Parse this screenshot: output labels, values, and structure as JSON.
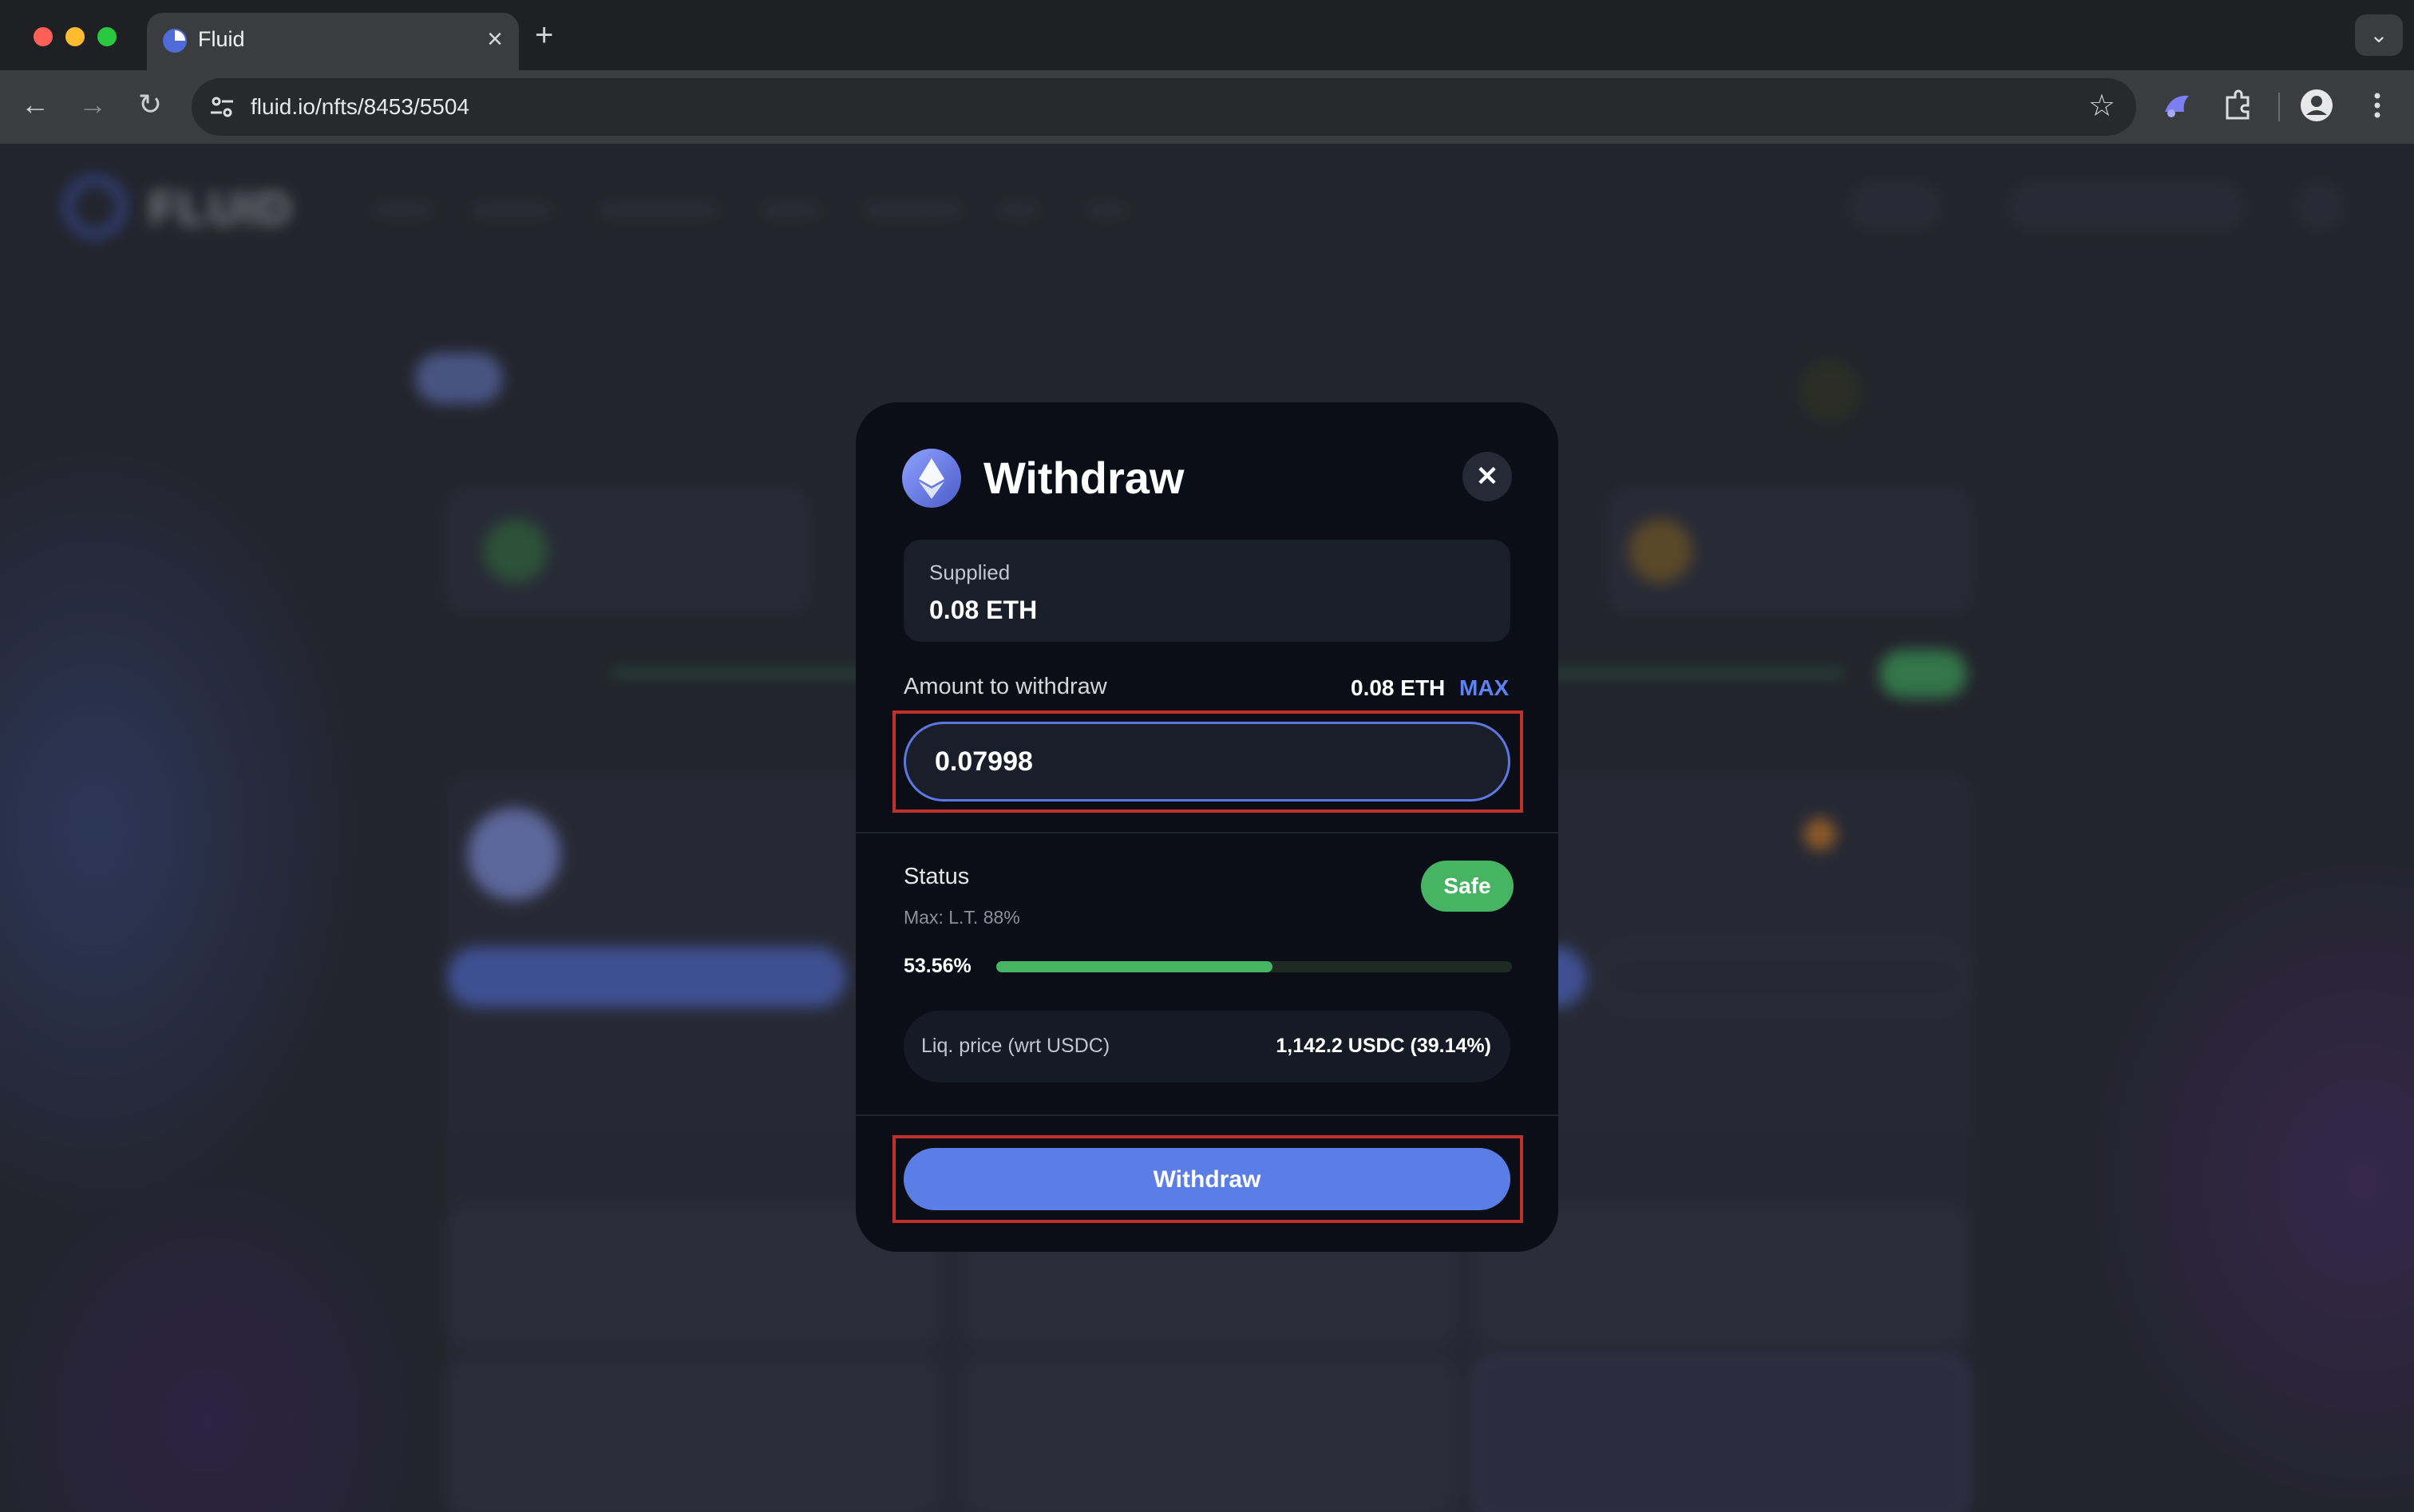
{
  "browser": {
    "tab_title": "Fluid",
    "url": "fluid.io/nfts/8453/5504"
  },
  "modal": {
    "title": "Withdraw",
    "supplied_label": "Supplied",
    "supplied_value": "0.08 ETH",
    "amount_label": "Amount to withdraw",
    "amount_balance": "0.08 ETH",
    "max_label": "MAX",
    "amount_input_value": "0.07998",
    "status_label": "Status",
    "status_badge": "Safe",
    "max_lt": "Max: L.T. 88%",
    "ltv_percent": "53.56%",
    "ltv_fraction": 0.5356,
    "liq_label": "Liq. price (wrt USDC)",
    "liq_value": "1,142.2 USDC  (39.14%)",
    "withdraw_button": "Withdraw"
  },
  "colors": {
    "accent": "#5b7de6",
    "safe": "#47b464",
    "highlight_box": "#c0302a",
    "modal_bg": "#0b0e16"
  },
  "icons": [
    "back-arrow-icon",
    "forward-arrow-icon",
    "reload-icon",
    "site-info-icon",
    "star-icon",
    "extension-icon",
    "profile-icon",
    "kebab-menu-icon",
    "ethereum-icon",
    "close-icon"
  ]
}
